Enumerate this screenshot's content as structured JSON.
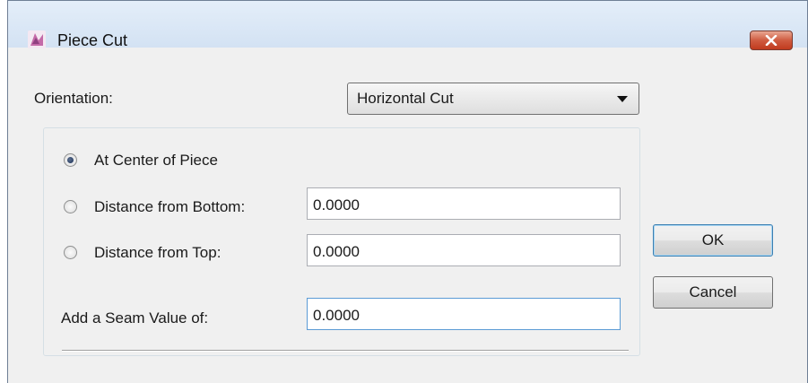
{
  "window": {
    "title": "Piece Cut",
    "icon": "piece-cut-app-icon",
    "close_icon": "close-icon"
  },
  "orientation": {
    "label": "Orientation:",
    "selected": "Horizontal Cut"
  },
  "cut_options": {
    "at_center": {
      "label": "At Center of Piece",
      "checked": true
    },
    "from_bottom": {
      "label": "Distance from Bottom:",
      "value": "0.0000",
      "checked": false
    },
    "from_top": {
      "label": "Distance from Top:",
      "value": "0.0000",
      "checked": false
    }
  },
  "seam": {
    "label": "Add a Seam Value of:",
    "value": "0.0000"
  },
  "buttons": {
    "ok": "OK",
    "cancel": "Cancel"
  },
  "colors": {
    "close_button": "#c13b1e",
    "focus_border": "#5b9bd5",
    "default_button_border": "#3c7fb1"
  }
}
